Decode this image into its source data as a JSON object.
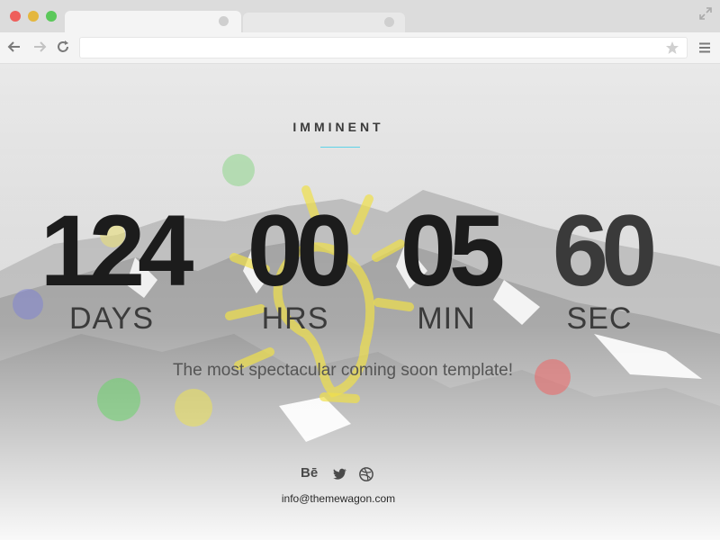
{
  "browser": {
    "address_value": "",
    "address_placeholder": ""
  },
  "page": {
    "brand": "IMMINENT",
    "countdown": [
      {
        "value": "124",
        "label": "DAYS"
      },
      {
        "value": "00",
        "label": "HRS"
      },
      {
        "value": "05",
        "label": "MIN"
      },
      {
        "value": "60",
        "label": "SEC"
      }
    ],
    "tagline": "The most spectacular coming soon template!",
    "social": [
      {
        "icon": "behance-icon",
        "glyph": "Bē"
      },
      {
        "icon": "twitter-icon",
        "glyph": ""
      },
      {
        "icon": "dribbble-icon",
        "glyph": ""
      }
    ],
    "email": "info@themewagon.com"
  },
  "colors": {
    "accent_line": "#5ed3e8",
    "traffic_red": "#ee5f5b",
    "traffic_yellow": "#e4b73f",
    "traffic_green": "#5bc85a"
  }
}
